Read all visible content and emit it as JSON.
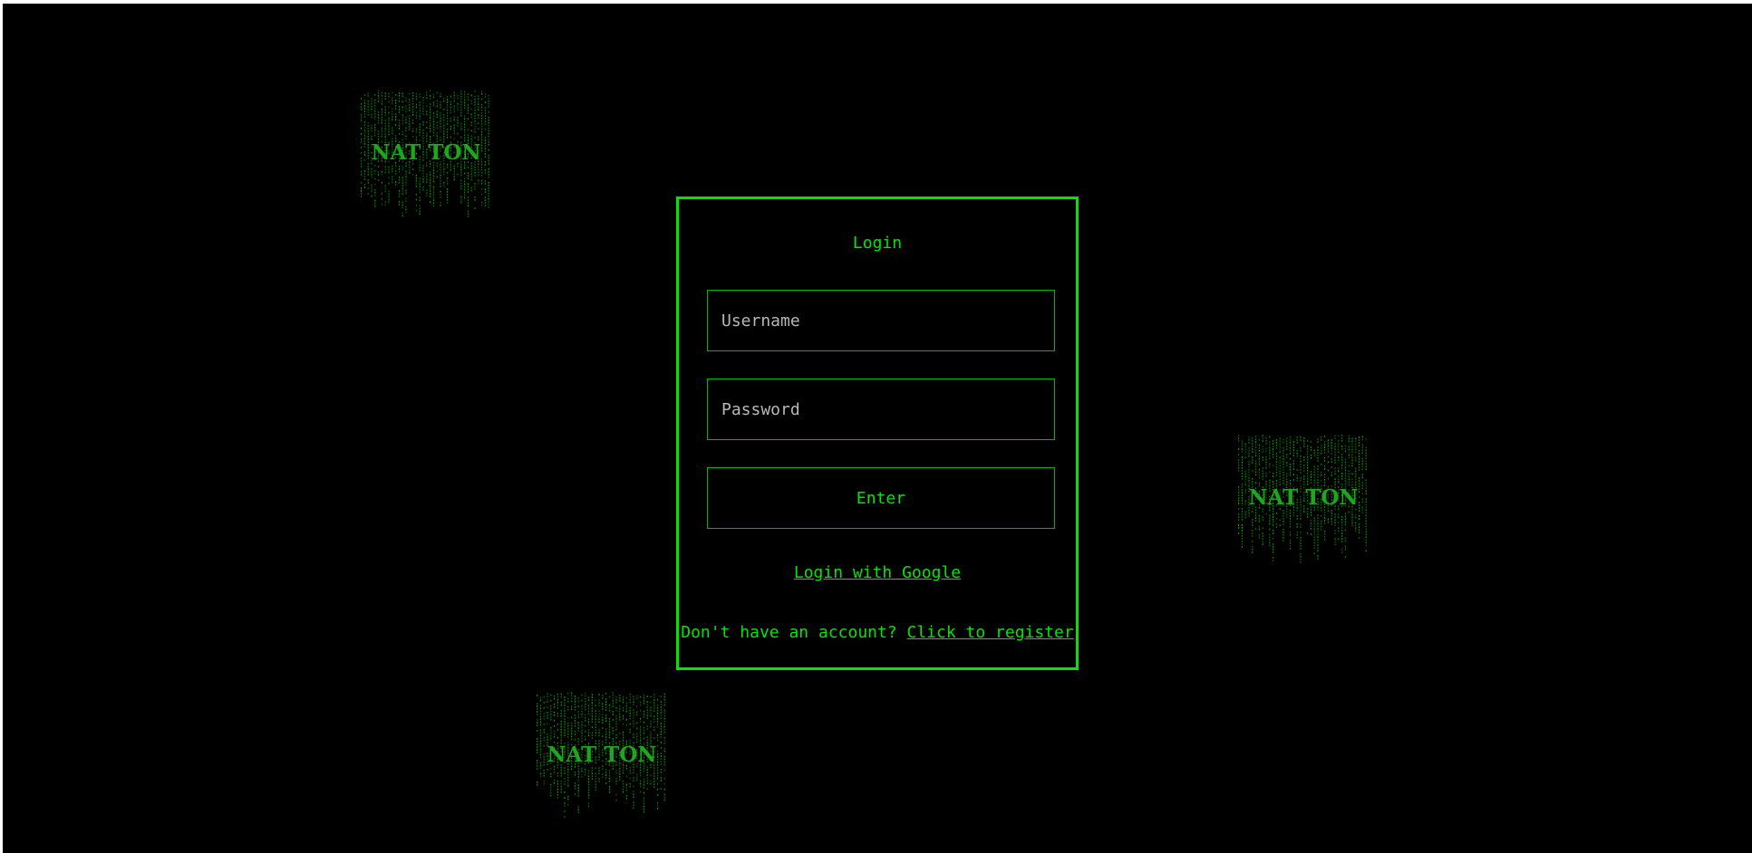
{
  "background": {
    "color": "#000000",
    "accent": "#00e600",
    "logo_color": "#1fa51f"
  },
  "logos": [
    {
      "text": "NAT TON"
    },
    {
      "text": "NAT TON"
    },
    {
      "text": "NAT TON"
    }
  ],
  "login": {
    "title": "Login",
    "username_placeholder": "Username",
    "password_placeholder": "Password",
    "enter_label": "Enter",
    "google_label": "Login with Google",
    "register_prompt": "Don't have an account?",
    "register_link": "Click to register"
  }
}
